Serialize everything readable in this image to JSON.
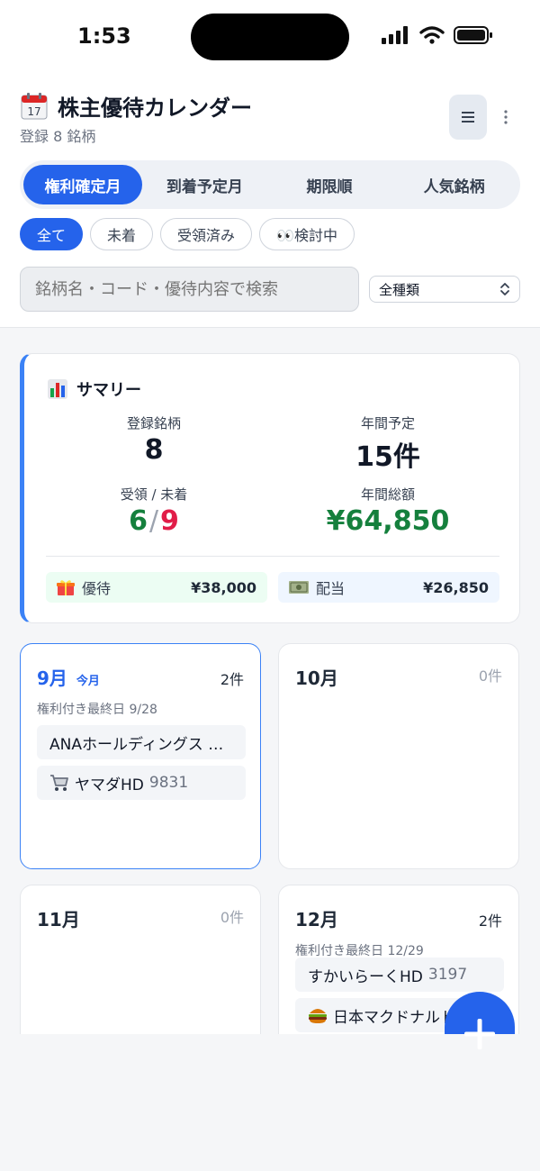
{
  "status_bar": {
    "time": "1:53"
  },
  "header": {
    "title": "株主優待カレンダー",
    "subtitle": "登録 8 銘柄",
    "tabs": [
      {
        "label": "権利確定月",
        "active": true
      },
      {
        "label": "到着予定月",
        "active": false
      },
      {
        "label": "期限順",
        "active": false
      },
      {
        "label": "人気銘柄",
        "active": false
      }
    ],
    "chips": [
      {
        "label": "全て",
        "active": true
      },
      {
        "label": "未着",
        "active": false
      },
      {
        "label": "受領済み",
        "active": false
      },
      {
        "label": "👀検討中",
        "active": false
      }
    ],
    "search_placeholder": "銘柄名・コード・優待内容で検索",
    "type_select": "全種類"
  },
  "summary": {
    "title": "サマリー",
    "registered_label": "登録銘柄",
    "registered_value": "8",
    "annual_plan_label": "年間予定",
    "annual_plan_value": "15件",
    "received_label": "受領 / 未着",
    "received": "6",
    "separator": "/",
    "not_arrived": "9",
    "annual_total_label": "年間総額",
    "annual_total_value": "¥64,850",
    "benefit_label": "優待",
    "benefit_amount": "¥38,000",
    "dividend_label": "配当",
    "dividend_amount": "¥26,850"
  },
  "months": [
    {
      "name": "9月",
      "today_label": "今月",
      "count": "2件",
      "deadline": "権利付き最終日 9/28",
      "items": [
        {
          "name": "ANAホールディングス …",
          "code": ""
        },
        {
          "name": "ヤマダHD",
          "code": "9831"
        }
      ]
    },
    {
      "name": "10月",
      "count": "0件"
    },
    {
      "name": "11月",
      "count": "0件"
    },
    {
      "name": "12月",
      "count": "2件",
      "deadline": "権利付き最終日 12/29",
      "items": [
        {
          "name": "すかいらーくHD",
          "code": "3197"
        },
        {
          "name": "日本マクドナルド",
          "code": ""
        }
      ]
    }
  ],
  "colors": {
    "accent": "#2563eb",
    "received_green": "#15803d",
    "not_arrived_red": "#e11d48",
    "total_green": "#15803d",
    "benefit_bg": "#ecfdf3",
    "dividend_bg": "#eff6ff"
  },
  "icons": {
    "title": "calendar-icon",
    "summary": "bar-chart-icon",
    "benefit": "gift-icon",
    "dividend": "money-icon",
    "cart": "shopping-cart-icon",
    "burger": "hamburger-food-icon",
    "fab": "plus-icon"
  }
}
